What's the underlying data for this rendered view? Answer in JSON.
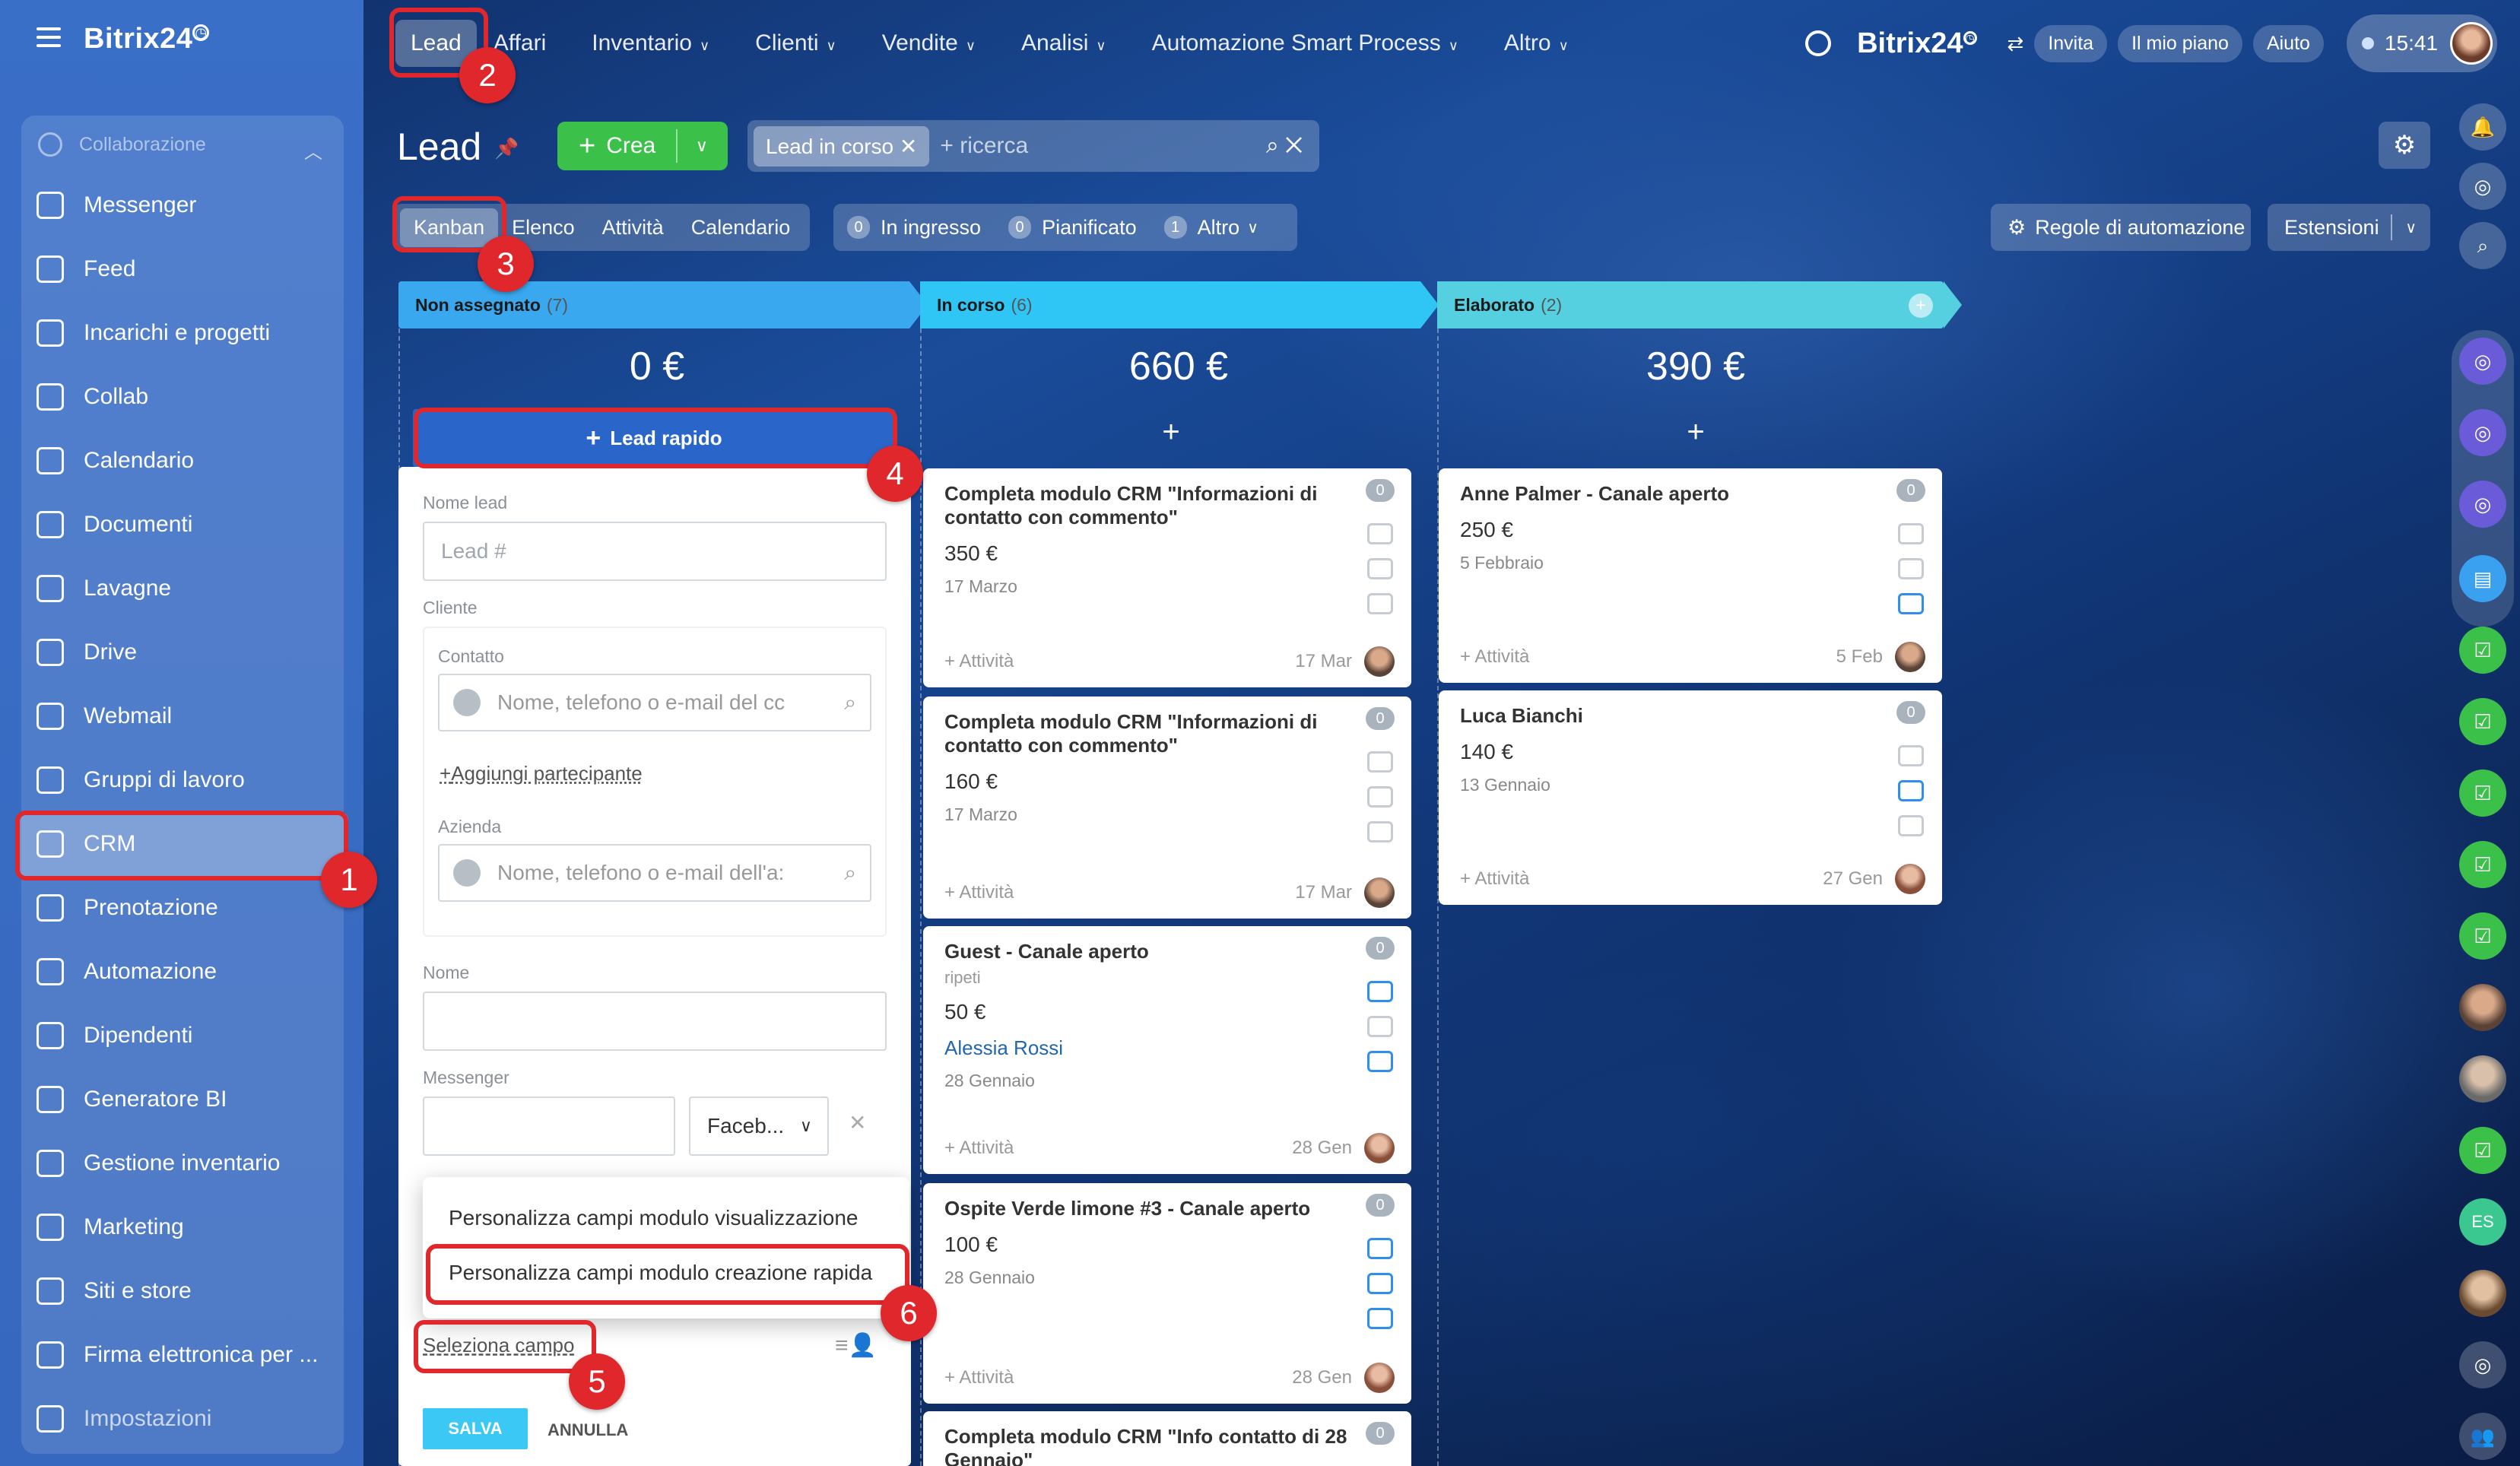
{
  "app": {
    "name": "Bitrix24",
    "title": "Lead"
  },
  "sidebar": {
    "section": "Collaborazione",
    "items": [
      {
        "label": "Messenger",
        "icon": "chat-icon"
      },
      {
        "label": "Feed",
        "icon": "feed-icon"
      },
      {
        "label": "Incarichi e progetti",
        "icon": "tasks-icon"
      },
      {
        "label": "Collab",
        "icon": "collab-icon"
      },
      {
        "label": "Calendario",
        "icon": "calendar-icon"
      },
      {
        "label": "Documenti",
        "icon": "documents-icon"
      },
      {
        "label": "Lavagne",
        "icon": "boards-icon"
      },
      {
        "label": "Drive",
        "icon": "drive-icon"
      },
      {
        "label": "Webmail",
        "icon": "mail-icon"
      },
      {
        "label": "Gruppi di lavoro",
        "icon": "groups-icon"
      },
      {
        "label": "CRM",
        "icon": "crm-icon"
      },
      {
        "label": "Prenotazione",
        "icon": "booking-icon"
      },
      {
        "label": "Automazione",
        "icon": "automation-icon"
      },
      {
        "label": "Dipendenti",
        "icon": "employees-icon"
      },
      {
        "label": "Generatore BI",
        "icon": "bi-icon"
      },
      {
        "label": "Gestione inventario",
        "icon": "inventory-icon"
      },
      {
        "label": "Marketing",
        "icon": "marketing-icon"
      },
      {
        "label": "Siti e store",
        "icon": "store-icon"
      },
      {
        "label": "Firma elettronica per ...",
        "icon": "signature-icon"
      },
      {
        "label": "Impostazioni",
        "icon": "settings-icon"
      }
    ]
  },
  "topnav": {
    "items": [
      {
        "label": "Lead",
        "dropdown": false
      },
      {
        "label": "Affari",
        "dropdown": false
      },
      {
        "label": "Inventario",
        "dropdown": true
      },
      {
        "label": "Clienti",
        "dropdown": true
      },
      {
        "label": "Vendite",
        "dropdown": true
      },
      {
        "label": "Analisi",
        "dropdown": true
      },
      {
        "label": "Automazione Smart Process",
        "dropdown": true
      },
      {
        "label": "Altro",
        "dropdown": true
      }
    ],
    "logo": "Bitrix24",
    "buttons": [
      "Invita",
      "Il mio piano",
      "Aiuto"
    ],
    "clock": "15:41"
  },
  "toolbar": {
    "create_label": "Crea",
    "filter_chip": "Lead in corso",
    "search_placeholder": "+ ricerca"
  },
  "views": {
    "tabs": [
      "Kanban",
      "Elenco",
      "Attività",
      "Calendario"
    ],
    "active": "Kanban"
  },
  "counters": [
    {
      "n": "0",
      "label": "In ingresso"
    },
    {
      "n": "0",
      "label": "Pianificato"
    },
    {
      "n": "1",
      "label": "Altro"
    }
  ],
  "right_toolbar": {
    "rules": "Regole di automazione",
    "extensions": "Estensioni"
  },
  "columns": [
    {
      "title": "Non assegnato",
      "count": "(7)",
      "sum": "0 €",
      "color": "#39a8ef"
    },
    {
      "title": "In corso",
      "count": "(6)",
      "sum": "660 €",
      "color": "#2fc6f6"
    },
    {
      "title": "Elaborato",
      "count": "(2)",
      "sum": "390 €",
      "color": "#55d0e0"
    }
  ],
  "quick_lead": "Lead rapido",
  "form": {
    "lead_name_label": "Nome lead",
    "lead_name_placeholder": "Lead #",
    "client_label": "Cliente",
    "contact_label": "Contatto",
    "contact_placeholder": "Nome, telefono o e-mail del cc",
    "add_participant": "Aggiungi partecipante",
    "company_label": "Azienda",
    "company_placeholder": "Nome, telefono o e-mail dell'a:",
    "name_label": "Nome",
    "messenger_label": "Messenger",
    "messenger_select": "Faceb...",
    "select_field": "Seleziona campo",
    "save": "SALVA",
    "cancel": "ANNULLA"
  },
  "popup": {
    "items": [
      "Personalizza campi modulo visualizzazione",
      "Personalizza campi modulo creazione rapida"
    ]
  },
  "cards_in_corso": [
    {
      "title": "Completa modulo CRM \"Informazioni di contatto con commento\"",
      "amount": "350 €",
      "date": "17 Marzo",
      "activity": "+ Attività",
      "deadline": "17 Mar",
      "counter": "0"
    },
    {
      "title": "Completa modulo CRM \"Informazioni di contatto con commento\"",
      "amount": "160 €",
      "date": "17 Marzo",
      "activity": "+ Attività",
      "deadline": "17 Mar",
      "counter": "0"
    },
    {
      "title": "Guest - Canale aperto",
      "sub": "ripeti",
      "amount": "50 €",
      "contact": "Alessia Rossi",
      "date": "28 Gennaio",
      "activity": "+ Attività",
      "deadline": "28 Gen",
      "counter": "0"
    },
    {
      "title": "Ospite Verde limone #3 - Canale aperto",
      "amount": "100 €",
      "date": "28 Gennaio",
      "activity": "+ Attività",
      "deadline": "28 Gen",
      "counter": "0"
    },
    {
      "title": "Completa modulo CRM \"Info contatto di 28 Gennaio\"",
      "counter": "0"
    }
  ],
  "cards_elaborato": [
    {
      "title": "Anne Palmer - Canale aperto",
      "amount": "250 €",
      "date": "5 Febbraio",
      "activity": "+ Attività",
      "deadline": "5 Feb",
      "counter": "0"
    },
    {
      "title": "Luca Bianchi",
      "amount": "140 €",
      "date": "13 Gennaio",
      "activity": "+ Attività",
      "deadline": "27 Gen",
      "counter": "0"
    }
  ],
  "steps": [
    "1",
    "2",
    "3",
    "4",
    "5",
    "6"
  ],
  "right_bar": {
    "user_initials": "ES"
  }
}
